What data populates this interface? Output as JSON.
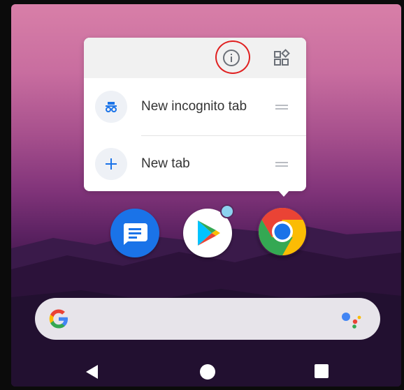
{
  "popup": {
    "header": {
      "app_info_icon": "info-icon",
      "widgets_icon": "widgets-icon"
    },
    "items": [
      {
        "label": "New incognito tab",
        "icon": "incognito-icon"
      },
      {
        "label": "New tab",
        "icon": "plus-icon"
      }
    ]
  },
  "dock": {
    "apps": [
      {
        "name": "Messages",
        "icon": "messages-icon"
      },
      {
        "name": "Play Store",
        "icon": "play-store-icon",
        "has_notification": true
      },
      {
        "name": "Chrome",
        "icon": "chrome-icon"
      }
    ]
  },
  "search_bar": {
    "left_icon": "google-icon",
    "right_icon": "assistant-icon"
  },
  "navigation": {
    "buttons": [
      "back",
      "home",
      "recents"
    ]
  },
  "colors": {
    "highlight": "#e02020",
    "accent_blue": "#1a73e8",
    "icon_gray": "#6b7078"
  }
}
